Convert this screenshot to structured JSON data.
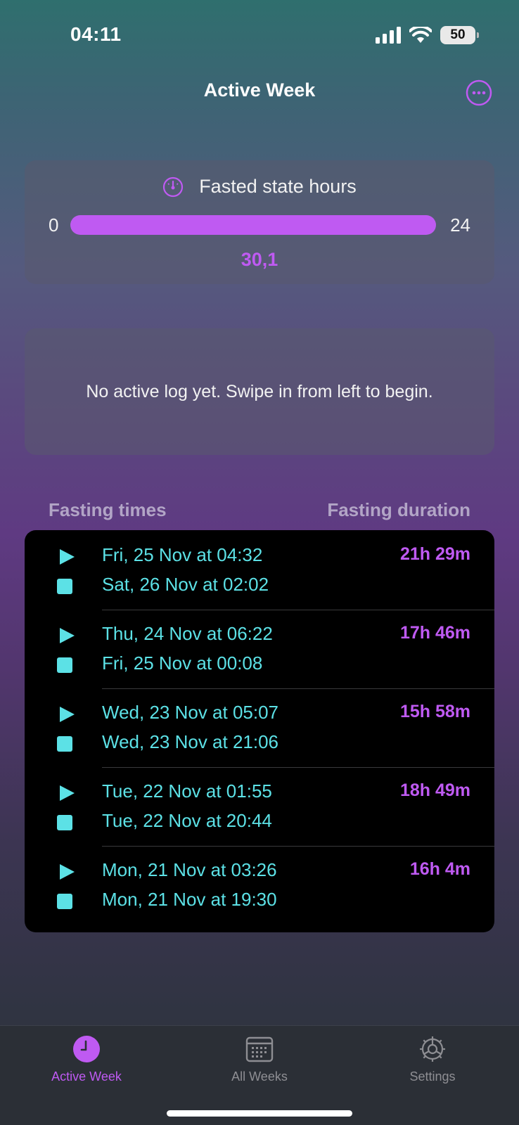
{
  "status_bar": {
    "time": "04:11",
    "battery": "50",
    "icons": [
      "cellular-signal-icon",
      "wifi-icon",
      "battery-icon"
    ]
  },
  "nav": {
    "title": "Active Week",
    "more_icon": "ellipsis-circle-icon"
  },
  "fasted_card": {
    "icon": "gauge-icon",
    "title": "Fasted state hours",
    "min_label": "0",
    "max_label": "24",
    "value": "30,1",
    "fill_fraction": 1.0
  },
  "empty_card": {
    "message": "No active log yet. Swipe in from left to begin."
  },
  "section_header": {
    "left": "Fasting times",
    "right": "Fasting duration"
  },
  "logs": [
    {
      "start": "Fri, 25 Nov at 04:32",
      "end": "Sat, 26 Nov at 02:02",
      "duration": "21h 29m"
    },
    {
      "start": "Thu, 24 Nov at 06:22",
      "end": "Fri, 25 Nov at 00:08",
      "duration": "17h 46m"
    },
    {
      "start": "Wed, 23 Nov at 05:07",
      "end": "Wed, 23 Nov at 21:06",
      "duration": "15h 58m"
    },
    {
      "start": "Tue, 22 Nov at 01:55",
      "end": "Tue, 22 Nov at 20:44",
      "duration": "18h 49m"
    },
    {
      "start": "Mon, 21 Nov at 03:26",
      "end": "Mon, 21 Nov at 19:30",
      "duration": "16h 4m"
    }
  ],
  "tabs": [
    {
      "label": "Active Week",
      "icon": "clock-icon",
      "active": true
    },
    {
      "label": "All Weeks",
      "icon": "calendar-icon",
      "active": false
    },
    {
      "label": "Settings",
      "icon": "gear-icon",
      "active": false
    }
  ],
  "colors": {
    "accent": "#bf5af2",
    "cyan": "#5ce1e6"
  }
}
